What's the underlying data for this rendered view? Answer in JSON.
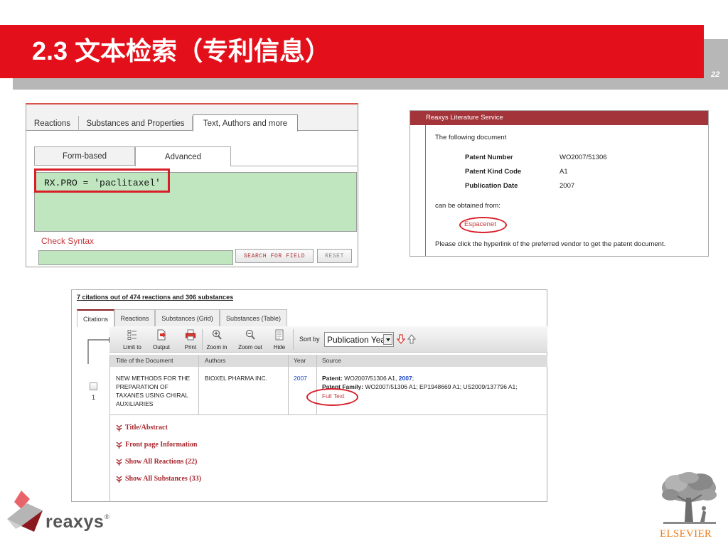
{
  "slide": {
    "title": "2.3 文本检索（专利信息）",
    "page_number": "22"
  },
  "query_panel": {
    "tabs": [
      "Reactions",
      "Substances and Properties",
      "Text, Authors and more"
    ],
    "subtabs": [
      "Form-based",
      "Advanced"
    ],
    "query": "RX.PRO = 'paclitaxel'",
    "check_syntax": "Check Syntax",
    "search_button": "SEARCH FOR FIELD",
    "reset_button": "RESET"
  },
  "literature_panel": {
    "header": "Reaxys Literature Service",
    "intro": "The following document",
    "fields": [
      {
        "label": "Patent Number",
        "value": "WO2007/51306"
      },
      {
        "label": "Patent Kind Code",
        "value": "A1"
      },
      {
        "label": "Publication Date",
        "value": "2007"
      }
    ],
    "obtained_from": "can be obtained from:",
    "vendor_link": "Espacenet",
    "instruction": "Please click the hyperlink of the preferred vendor to get the patent document."
  },
  "results_panel": {
    "summary": "7 citations out of 474 reactions and 306 substances",
    "tabs": [
      "Citations",
      "Reactions",
      "Substances (Grid)",
      "Substances (Table)"
    ],
    "toolbar": [
      {
        "label": "Limit to",
        "icon": "checklist-icon"
      },
      {
        "label": "Output",
        "icon": "output-icon"
      },
      {
        "label": "Print",
        "icon": "printer-icon"
      },
      {
        "label": "Zoom in",
        "icon": "zoom-in-icon"
      },
      {
        "label": "Zoom out",
        "icon": "zoom-out-icon"
      },
      {
        "label": "Hide",
        "icon": "hide-icon"
      }
    ],
    "sort_label": "Sort by",
    "sort_value": "Publication Year",
    "columns": [
      "Title of the Document",
      "Authors",
      "Year",
      "Source"
    ],
    "row": {
      "number": "1",
      "title_lines": [
        "NEW METHODS FOR THE",
        "PREPARATION OF",
        "TAXANES USING CHIRAL",
        "AUXILIARIES"
      ],
      "authors": "BIOXEL PHARMA INC.",
      "year": "2007",
      "patent_label": "Patent:",
      "patent_value": "WO2007/51306 A1,",
      "patent_year": "2007",
      "patent_suffix": ";",
      "family_label": "Patent Family:",
      "family_value": "WO2007/51306 A1; EP1948669 A1; US2009/137796 A1;",
      "full_text": "Full Text"
    },
    "expanders": [
      "Title/Abstract",
      "Front page Information",
      "Show All Reactions (22)",
      "Show All Substances (33)"
    ]
  },
  "logos": {
    "reaxys": "reaxys",
    "registered": "®",
    "elsevier": "ELSEVIER"
  },
  "colors": {
    "banner": "#e3101b",
    "accent": "#d81e28",
    "link_blue": "#1c45c4",
    "green": "#bfe6bf",
    "orange": "#f07d19",
    "lit_header": "#a3343a",
    "expander": "#a8282e"
  }
}
